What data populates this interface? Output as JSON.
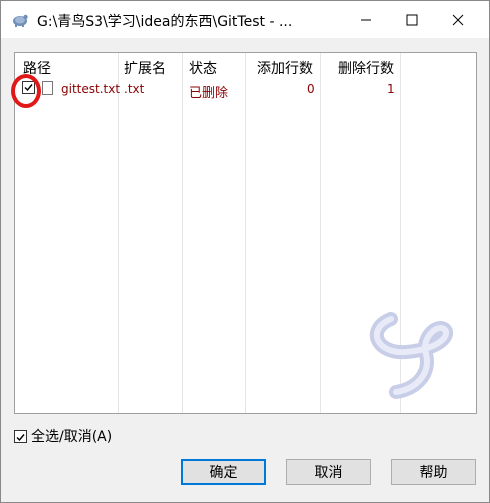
{
  "window": {
    "title": "G:\\青鸟S3\\学习\\idea的东西\\GitTest - ...",
    "icon": "tortoise-icon"
  },
  "table": {
    "columns": [
      "路径",
      "扩展名",
      "状态",
      "添加行数",
      "删除行数"
    ],
    "rows": [
      {
        "checked": true,
        "path": "gittest.txt",
        "ext": ".txt",
        "status": "已删除",
        "added": "0",
        "deleted": "1"
      }
    ]
  },
  "select_all": {
    "label": "全选/取消(A)",
    "checked": true
  },
  "buttons": {
    "ok": "确定",
    "cancel": "取消",
    "help": "帮助"
  },
  "colors": {
    "accent": "#0078d7",
    "row_text": "#8b0000",
    "highlight_ring": "#e11818"
  }
}
